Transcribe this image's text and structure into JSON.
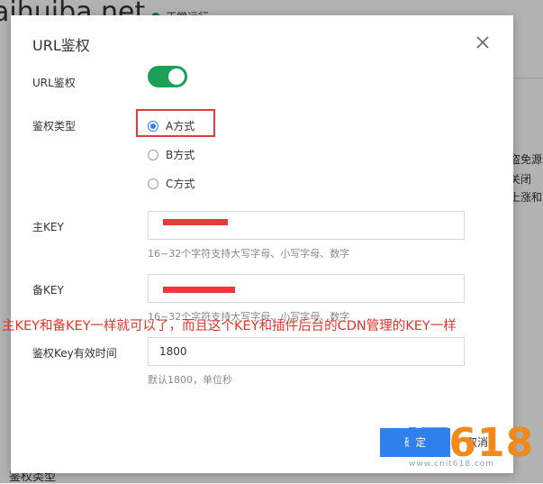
{
  "background": {
    "page_title": "aihuiba.net",
    "status_label": "正常运行",
    "side_texts": [
      "盗免源",
      "关闭",
      "上涨和"
    ],
    "footer_label": "鉴权类型"
  },
  "dialog": {
    "title": "URL鉴权",
    "fields": {
      "url_auth_label": "URL鉴权",
      "url_auth_enabled": true,
      "auth_type_label": "鉴权类型",
      "auth_type_options": [
        "A方式",
        "B方式",
        "C方式"
      ],
      "auth_type_selected": "A方式",
      "primary_key_label": "主KEY",
      "primary_key_hint": "16~32个字符支持大写字母、小写字母、数字",
      "backup_key_label": "备KEY",
      "backup_key_hint": "16~32个字符支持大写字母、小写字母、数字",
      "ttl_label": "鉴权Key有效时间",
      "ttl_value": "1800",
      "ttl_hint": "默认1800，单位秒"
    },
    "buttons": {
      "confirm": "确定",
      "cancel": "取消"
    }
  },
  "annotation_text": "主KEY和备KEY一样就可以了，而且这个KEY和插件后台的CDN管理的KEY一样",
  "watermark": {
    "logo_it": "IT",
    "logo_num": "618",
    "url": "www.cnit618.com"
  },
  "colors": {
    "primary": "#2f80ed",
    "switch_on": "#1aa157",
    "annotation": "#e0342c",
    "highlight_border": "#e03d3d"
  }
}
